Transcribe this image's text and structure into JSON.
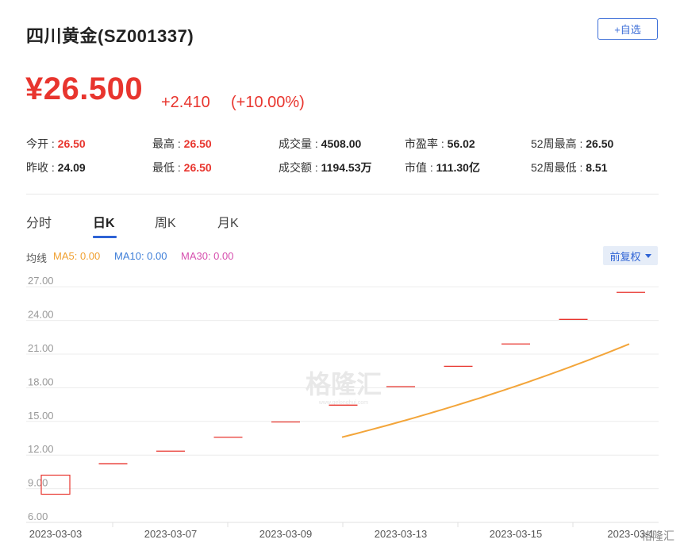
{
  "header": {
    "title": "四川黄金(SZ001337)",
    "watch_label": "+自选"
  },
  "quote": {
    "price": "¥26.500",
    "change": "+2.410",
    "change_pct": "(+10.00%)"
  },
  "stats": [
    {
      "label": "今开 : ",
      "value": "26.50",
      "color": "red"
    },
    {
      "label": "最高 : ",
      "value": "26.50",
      "color": "red"
    },
    {
      "label": "成交量 : ",
      "value": "4508.00",
      "color": "dark"
    },
    {
      "label": "市盈率 : ",
      "value": "56.02",
      "color": "dark"
    },
    {
      "label": "52周最高 : ",
      "value": "26.50",
      "color": "dark"
    },
    {
      "label": "昨收 : ",
      "value": "24.09",
      "color": "dark"
    },
    {
      "label": "最低 : ",
      "value": "26.50",
      "color": "red"
    },
    {
      "label": "成交额 : ",
      "value": "1194.53万",
      "color": "dark"
    },
    {
      "label": "市值 : ",
      "value": "111.30亿",
      "color": "dark"
    },
    {
      "label": "52周最低 : ",
      "value": "8.51",
      "color": "dark"
    }
  ],
  "tabs": [
    "分时",
    "日K",
    "周K",
    "月K"
  ],
  "active_tab": "日K",
  "ma": {
    "label": "均线",
    "ma5": "MA5: 0.00",
    "ma10": "MA10: 0.00",
    "ma30": "MA30: 0.00",
    "colors": {
      "ma5": "#f0a030",
      "ma10": "#3d7ed8",
      "ma30": "#d64fae"
    }
  },
  "adjust_label": "前复权",
  "watermark": "格隆汇",
  "watermark_sub": "www.gelonghui.com",
  "corner_logo": "格隆汇",
  "colors": {
    "up": "#e8352e",
    "accent": "#2e63d5",
    "ma_line": "#f3a53a"
  },
  "chart_data": {
    "type": "candlestick",
    "y_ticks": [
      "27.00",
      "24.00",
      "21.00",
      "18.00",
      "15.00",
      "12.00",
      "9.00",
      "6.00"
    ],
    "x_tick_labels": [
      "2023-03-03",
      "2023-03-07",
      "2023-03-09",
      "2023-03-13",
      "2023-03-15",
      "2023-03-1"
    ],
    "ylim": [
      6,
      28.5
    ],
    "grid": true,
    "candles": [
      {
        "open": 8.51,
        "close": 10.21
      },
      {
        "open": 11.23,
        "close": 11.23
      },
      {
        "open": 12.35,
        "close": 12.35
      },
      {
        "open": 13.59,
        "close": 13.59
      },
      {
        "open": 14.95,
        "close": 14.95
      },
      {
        "open": 16.45,
        "close": 16.45
      },
      {
        "open": 18.1,
        "close": 18.1
      },
      {
        "open": 19.91,
        "close": 19.91
      },
      {
        "open": 21.9,
        "close": 21.9
      },
      {
        "open": 24.09,
        "close": 24.09
      },
      {
        "open": 26.5,
        "close": 26.5
      }
    ],
    "ma_line": {
      "start_index": 5.5,
      "values": [
        13.59,
        14.95,
        16.45,
        18.1,
        19.91,
        21.9
      ]
    }
  }
}
